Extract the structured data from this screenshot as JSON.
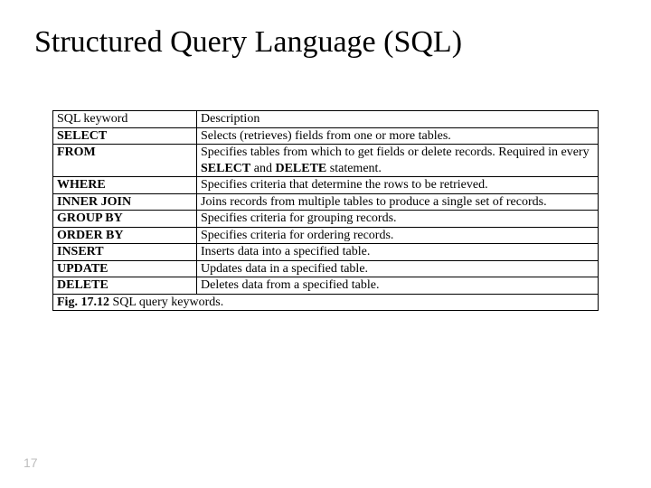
{
  "title": "Structured Query Language (SQL)",
  "header": {
    "kw": "SQL keyword",
    "desc": "Description"
  },
  "rows": [
    {
      "kw": "SELECT",
      "desc": "Selects (retrieves) fields from one or more tables."
    },
    {
      "kw": "FROM",
      "desc_pre": "Specifies tables from which to get fields or delete records. Required in every ",
      "b1": "SELECT",
      "mid": " and ",
      "b2": "DELETE",
      "desc_post": " statement."
    },
    {
      "kw": "WHERE",
      "desc": "Specifies criteria that determine the rows to be retrieved."
    },
    {
      "kw": "INNER JOIN",
      "desc": "Joins records from multiple tables to produce a single set of records."
    },
    {
      "kw": "GROUP BY",
      "desc": "Specifies criteria for grouping records."
    },
    {
      "kw": "ORDER BY",
      "desc": "Specifies criteria for ordering records."
    },
    {
      "kw": "INSERT",
      "desc": "Inserts data into a specified table."
    },
    {
      "kw": "UPDATE",
      "desc": "Updates data in a specified table."
    },
    {
      "kw": "DELETE",
      "desc": "Deletes data from a specified table."
    }
  ],
  "caption": {
    "fig": "Fig. 17.12",
    "text": "  SQL query keywords."
  },
  "page_number": "17"
}
